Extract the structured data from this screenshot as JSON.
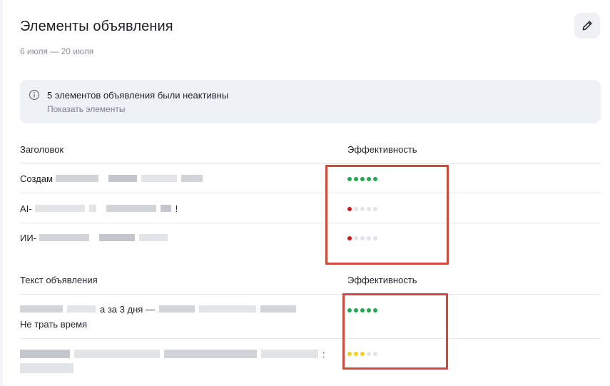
{
  "header": {
    "title": "Элементы объявления",
    "date_range": "6 июля — 20 июля"
  },
  "notice": {
    "title": "5 элементов объявления были неактивны",
    "link": "Показать элементы"
  },
  "headlines": {
    "column_title": "Заголовок",
    "column_efficiency": "Эффективность",
    "rows": [
      {
        "text": "Создам",
        "efficiency": 5,
        "level_color": "#22a654"
      },
      {
        "text": "AI-",
        "suffix": "!",
        "efficiency": 1,
        "level_color": "#d01818"
      },
      {
        "text": "ИИ-",
        "efficiency": 1,
        "level_color": "#d01818"
      }
    ]
  },
  "ad_texts": {
    "column_title": "Текст объявления",
    "column_efficiency": "Эффективность",
    "rows": [
      {
        "text_line1": "а за 3 дня —",
        "text_line2": "Не трать время",
        "efficiency": 5,
        "level_color": "#22a654"
      },
      {
        "text_line1": ":",
        "efficiency": 3,
        "level_color": "#f2d01e"
      }
    ]
  },
  "colors": {
    "highlight": "#cc4b3c",
    "dot_inactive": "#e1e3e8"
  }
}
